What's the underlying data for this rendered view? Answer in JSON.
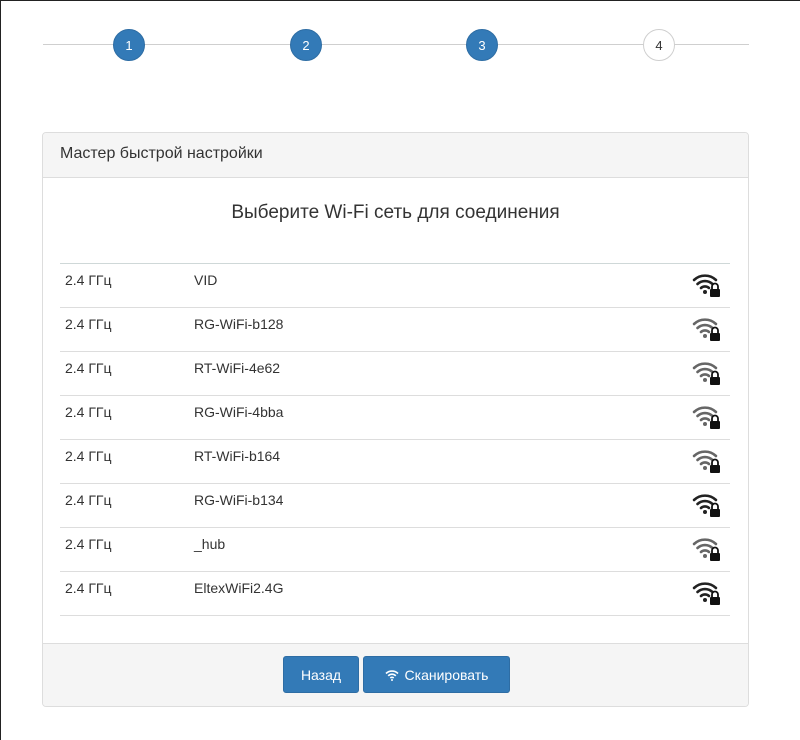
{
  "stepper": {
    "steps": [
      {
        "label": "1",
        "state": "done"
      },
      {
        "label": "2",
        "state": "done"
      },
      {
        "label": "3",
        "state": "done"
      },
      {
        "label": "4",
        "state": "todo"
      }
    ]
  },
  "panel": {
    "heading": "Мастер быстрой настройки",
    "title": "Выберите Wi-Fi сеть для соединения",
    "networks": [
      {
        "freq": "2.4 ГГц",
        "ssid": "VID",
        "signal_icon": "wifi-locked-icon",
        "signal_strength": "strong"
      },
      {
        "freq": "2.4 ГГц",
        "ssid": "RG-WiFi-b128",
        "signal_icon": "wifi-locked-icon",
        "signal_strength": "medium"
      },
      {
        "freq": "2.4 ГГц",
        "ssid": "RT-WiFi-4e62",
        "signal_icon": "wifi-locked-icon",
        "signal_strength": "medium"
      },
      {
        "freq": "2.4 ГГц",
        "ssid": "RG-WiFi-4bba",
        "signal_icon": "wifi-locked-icon",
        "signal_strength": "medium"
      },
      {
        "freq": "2.4 ГГц",
        "ssid": "RT-WiFi-b164",
        "signal_icon": "wifi-locked-icon",
        "signal_strength": "medium"
      },
      {
        "freq": "2.4 ГГц",
        "ssid": "RG-WiFi-b134",
        "signal_icon": "wifi-locked-icon",
        "signal_strength": "strong"
      },
      {
        "freq": "2.4 ГГц",
        "ssid": "_hub",
        "signal_icon": "wifi-locked-icon",
        "signal_strength": "medium"
      },
      {
        "freq": "2.4 ГГц",
        "ssid": "EltexWiFi2.4G",
        "signal_icon": "wifi-locked-icon",
        "signal_strength": "strong"
      }
    ]
  },
  "footer": {
    "back_label": "Назад",
    "scan_label": "Сканировать",
    "scan_icon": "wifi-icon"
  },
  "colors": {
    "accent": "#337ab7",
    "panel_bg": "#f5f5f5",
    "border": "#dddddd"
  }
}
